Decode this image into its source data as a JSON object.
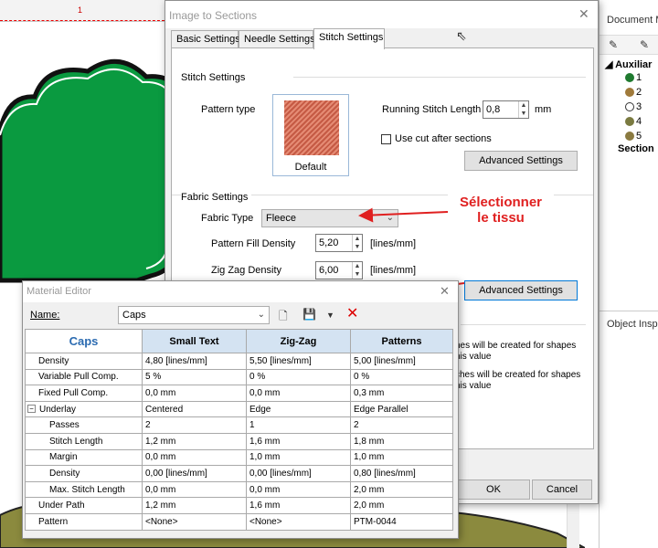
{
  "ruler": {
    "marker": "1"
  },
  "right_panel": {
    "title": "Document M",
    "tree": {
      "header": "Auxiliar",
      "items": [
        {
          "label": "1",
          "color": "#1f7a2f"
        },
        {
          "label": "2",
          "color": "#a07a3a"
        },
        {
          "label": "3",
          "color": "#ffffff"
        },
        {
          "label": "4",
          "color": "#7a7a40"
        },
        {
          "label": "5",
          "color": "#8a7a40"
        }
      ],
      "footer": "Section"
    },
    "object_inspector": "Object Inspe"
  },
  "sections_dialog": {
    "title": "Image to Sections",
    "tabs": [
      "Basic Settings",
      "Needle Settings",
      "Stitch Settings"
    ],
    "active_tab": "Stitch Settings",
    "stitch_settings_header": "Stitch Settings",
    "pattern_type_label": "Pattern type",
    "pattern_caption": "Default",
    "running_stitch_label": "Running Stitch Length",
    "running_stitch_value": "0,8",
    "running_stitch_unit": "mm",
    "use_cut_label": "Use cut after sections",
    "advanced_settings_label": "Advanced Settings",
    "fabric_settings_header": "Fabric Settings",
    "fabric_type_label": "Fabric Type",
    "fabric_type_value": "Fleece",
    "pattern_fill_density_label": "Pattern Fill Density",
    "pattern_fill_density_value": "5,20",
    "zigzag_density_label": "Zig Zag Density",
    "zigzag_density_value": "6,00",
    "density_unit": "[lines/mm]",
    "advanced_settings_2_label": "Advanced Settings",
    "note_1a": "hes will be created for shapes",
    "note_1b": "his value",
    "note_2a": "ches will be created for shapes",
    "note_2b": "his value",
    "ok_label": "OK",
    "cancel_label": "Cancel"
  },
  "annotation": {
    "line1": "Sélectionner",
    "line2": "le tissu",
    "color": "#e02020"
  },
  "material_editor": {
    "title": "Material Editor",
    "name_label": "Name:",
    "name_value": "Caps",
    "grid": {
      "corner": "Caps",
      "columns": [
        "Small Text",
        "Zig-Zag",
        "Patterns"
      ],
      "rows": [
        {
          "name": "Density",
          "values": [
            "4,80 [lines/mm]",
            "5,50 [lines/mm]",
            "5,00 [lines/mm]"
          ]
        },
        {
          "name": "Variable Pull Comp.",
          "values": [
            "5 %",
            "0 %",
            "0 %"
          ]
        },
        {
          "name": "Fixed Pull Comp.",
          "values": [
            "0,0 mm",
            "0,0 mm",
            "0,3 mm"
          ]
        },
        {
          "name": "Underlay",
          "values": [
            "Centered",
            "Edge",
            "Edge Parallel"
          ]
        },
        {
          "name": "Passes",
          "values": [
            "2",
            "1",
            "2"
          ]
        },
        {
          "name": "Stitch Length",
          "values": [
            "1,2 mm",
            "1,6 mm",
            "1,8 mm"
          ]
        },
        {
          "name": "Margin",
          "values": [
            "0,0 mm",
            "1,0 mm",
            "1,0 mm"
          ]
        },
        {
          "name": "Density",
          "values": [
            "0,00 [lines/mm]",
            "0,00 [lines/mm]",
            "0,80 [lines/mm]"
          ]
        },
        {
          "name": "Max. Stitch Length",
          "values": [
            "0,0 mm",
            "0,0 mm",
            "2,0 mm"
          ]
        },
        {
          "name": "Under Path",
          "values": [
            "1,2 mm",
            "1,6 mm",
            "2,0 mm"
          ]
        },
        {
          "name": "Pattern",
          "values": [
            "<None>",
            "<None>",
            "PTM-0044"
          ]
        }
      ]
    }
  }
}
